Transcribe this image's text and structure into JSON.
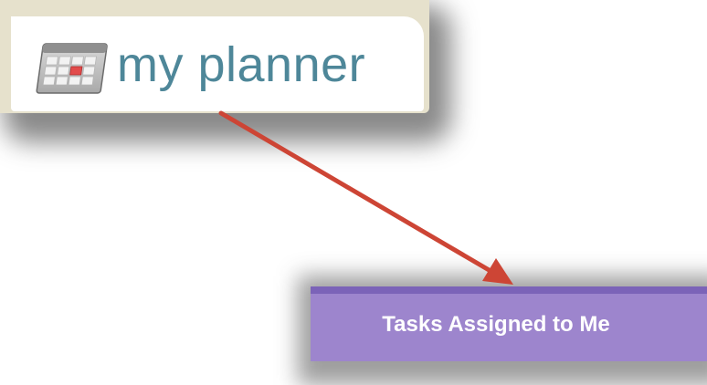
{
  "planner_link": {
    "label": "my planner",
    "icon": "calendar-icon"
  },
  "tasks_tab": {
    "label": "Tasks Assigned to Me"
  },
  "colors": {
    "planner_text": "#4e8799",
    "planner_bezel": "#e6e1cc",
    "arrow": "#cd4535",
    "tab_background": "#9d85cd",
    "tab_border": "#7b63b8",
    "tab_text": "#ffffff"
  }
}
